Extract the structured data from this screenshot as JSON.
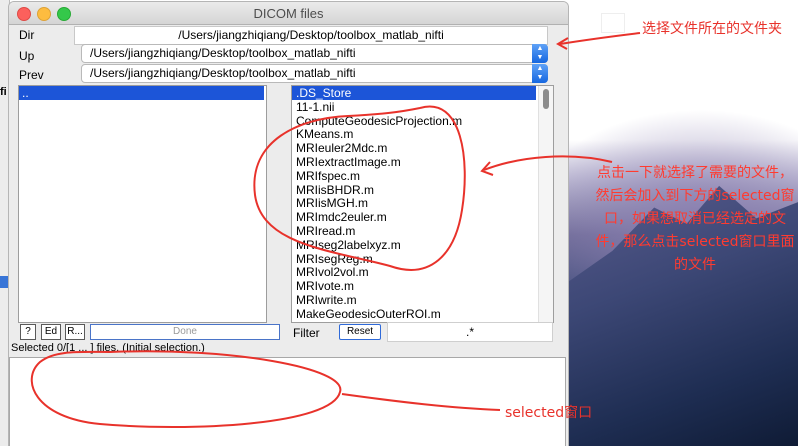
{
  "window": {
    "title": "DICOM files"
  },
  "left_strip": {
    "label": "fi"
  },
  "fields": {
    "dir_label": "Dir",
    "dir_value": "/Users/jiangzhiqiang/Desktop/toolbox_matlab_nifti",
    "up_label": "Up",
    "up_value": "/Users/jiangzhiqiang/Desktop/toolbox_matlab_nifti",
    "prev_label": "Prev",
    "prev_value": "/Users/jiangzhiqiang/Desktop/toolbox_matlab_nifti"
  },
  "left_list": {
    "items": [
      ".."
    ]
  },
  "right_list": {
    "items": [
      ".DS_Store",
      "11-1.nii",
      "ComputeGeodesicProjection.m",
      "KMeans.m",
      "MRIeuler2Mdc.m",
      "MRIextractImage.m",
      "MRIfspec.m",
      "MRIisBHDR.m",
      "MRIisMGH.m",
      "MRImdc2euler.m",
      "MRIread.m",
      "MRIseg2labelxyz.m",
      "MRIsegReg.m",
      "MRIvol2vol.m",
      "MRIvote.m",
      "MRIwrite.m",
      "MakeGeodesicOuterROI.m"
    ]
  },
  "buttons": {
    "help": "?",
    "edit": "Ed",
    "recursive": "R...",
    "done": "Done",
    "reset": "Reset"
  },
  "filter": {
    "label": "Filter",
    "value": ".*"
  },
  "status": {
    "text": "Selected 0/[1 ... ] files. (Initial selection.)"
  },
  "annotations": {
    "top": "选择文件所在的文件夹",
    "middle": "点击一下就选择了需要的文件，然后会加入到下方的selected窗口，如果想取消已经选定的文件，那么点击selected窗口里面的文件",
    "bottom": "selected窗口"
  },
  "colors": {
    "selection": "#1c55d8",
    "annotation": "#e8322b",
    "combo_arrow": "#1667e0"
  }
}
